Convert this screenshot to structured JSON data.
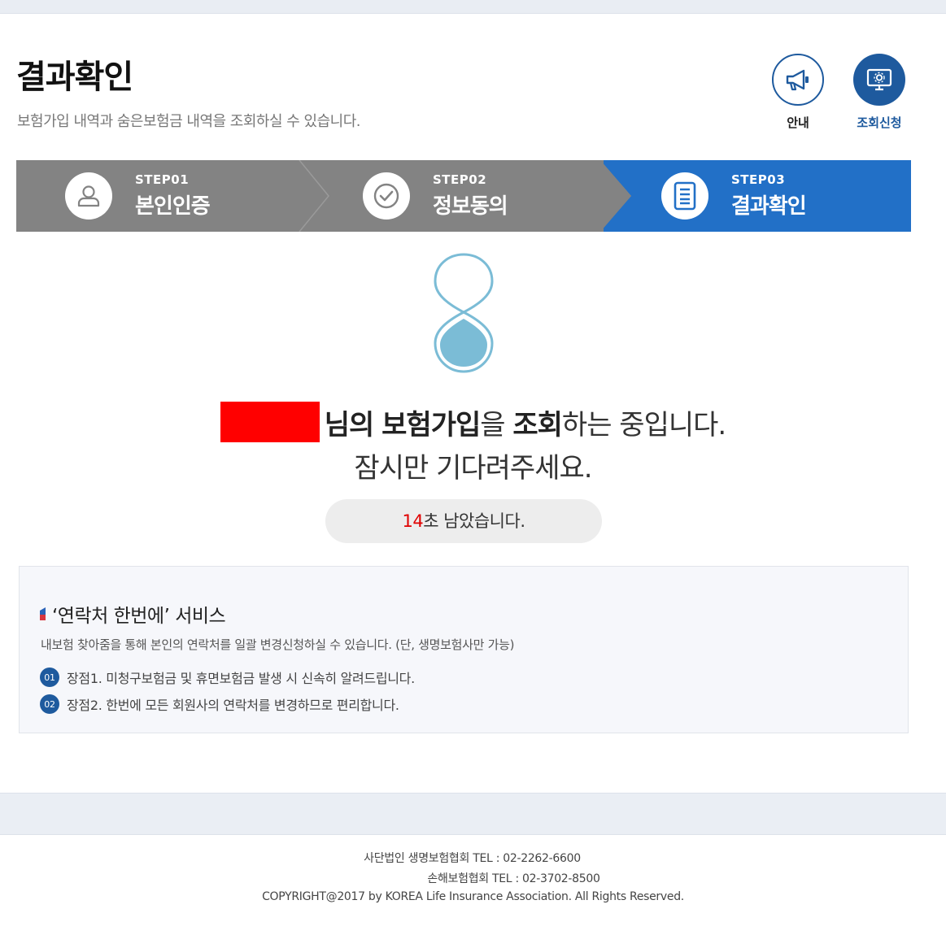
{
  "header": {
    "title": "결과확인",
    "description": "보험가입 내역과 숨은보험금 내역을 조회하실 수 있습니다."
  },
  "quick_links": {
    "info_label": "안내",
    "apply_label": "조회신청",
    "info_icon": "megaphone-icon",
    "apply_icon": "monitor-icon"
  },
  "steps": [
    {
      "number": "STEP01",
      "name": "본인인증",
      "icon": "user-icon",
      "state": "done"
    },
    {
      "number": "STEP02",
      "name": "정보동의",
      "icon": "check-circle-icon",
      "state": "done"
    },
    {
      "number": "STEP03",
      "name": "결과확인",
      "icon": "document-icon",
      "state": "active"
    }
  ],
  "status": {
    "name_suffix": "님의",
    "insurance_join": "보험가입",
    "particle_eul": "을",
    "inquiry": "조회",
    "in_progress": "하는 중입니다.",
    "please_wait": "잠시만 기다려주세요."
  },
  "timer": {
    "seconds": "14",
    "suffix": "초 남았습니다."
  },
  "service": {
    "title": "‘연락처 한번에’ 서비스",
    "description": "내보험 찾아줌을 통해 본인의 연락처를 일괄 변경신청하실 수 있습니다. (단, 생명보험사만 가능)",
    "benefits": [
      {
        "num": "01",
        "text": "장점1. 미청구보험금 및 휴면보험금 발생 시 신속히 알려드립니다."
      },
      {
        "num": "02",
        "text": "장점2. 한번에 모든 회원사의 연락처를 변경하므로 편리합니다."
      }
    ]
  },
  "footer": {
    "line1": "사단법인 생명보험협회 TEL : 02-2262-6600",
    "line2": "손해보험협회 TEL : 02-3702-8500",
    "copyright": "COPYRIGHT@2017 by KOREA Life Insurance Association. All Rights Reserved."
  },
  "colors": {
    "primary": "#1e5a9e",
    "active_step": "#2270c7",
    "inactive_step": "#838383",
    "timer_accent": "#e00000",
    "redaction": "#ff0000",
    "hourglass": "#7bbcd6"
  }
}
